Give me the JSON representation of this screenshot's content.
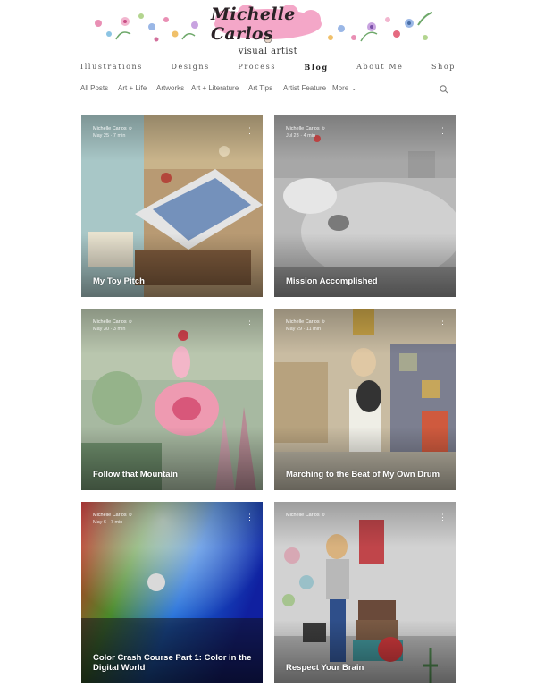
{
  "brand": {
    "logo_text": "Michelle Carlos",
    "subtitle": "visual artist"
  },
  "main_nav": [
    "Illustrations",
    "Designs",
    "Process",
    "Blog",
    "About Me",
    "Shop"
  ],
  "main_nav_active": "Blog",
  "categories": [
    "All Posts",
    "Art + Life",
    "Artworks",
    "Art + Literature",
    "Art Tips",
    "Artist Feature",
    "More"
  ],
  "posts": [
    {
      "author": "Michelle Carlos",
      "meta": "May 25 · 7 min",
      "title": "My Toy Pitch",
      "icon": "crown-icon"
    },
    {
      "author": "Michelle Carlos",
      "meta": "Jul 23 · 4 min",
      "title": "Mission Accomplished",
      "icon": "crown-icon"
    },
    {
      "author": "Michelle Carlos",
      "meta": "May 30 · 3 min",
      "title": "Follow that Mountain",
      "icon": "crown-icon"
    },
    {
      "author": "Michelle Carlos",
      "meta": "May 29 · 11 min",
      "title": "Marching to the Beat of My Own Drum",
      "icon": "crown-icon"
    },
    {
      "author": "Michelle Carlos",
      "meta": "May 6 · 7 min",
      "title": "Color Crash Course Part 1: Color in the Digital World",
      "icon": "crown-icon"
    },
    {
      "author": "Michelle Carlos",
      "meta": "",
      "title": "Respect Your Brain",
      "icon": "crown-icon"
    }
  ],
  "colors": {
    "nav_text": "#555555",
    "category_text": "#666666",
    "logo_pink": "#f4a7c8"
  }
}
